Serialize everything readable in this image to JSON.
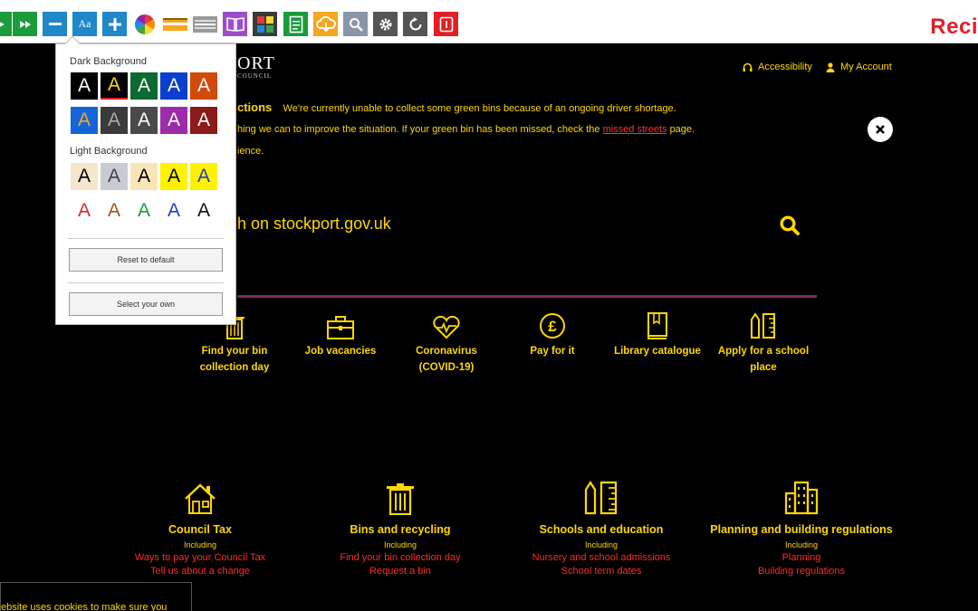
{
  "toolbar": {
    "text_size_label": "Aa",
    "brand": "Reci"
  },
  "header": {
    "logo_fragment": "ORT",
    "logo_sub": "COUNCIL",
    "accessibility": "Accessibility",
    "my_account": "My Account"
  },
  "alert": {
    "title": "ctions",
    "line1": "We're currently unable to collect some green bins because of an ongoing driver shortage.",
    "line2_pre": "hing we can to improve the situation. If your green bin has been missed, check the",
    "line2_link": "missed streets",
    "line2_post": "page.",
    "line3": "ience."
  },
  "search": {
    "text": "h on stockport.gov.uk"
  },
  "quick_links": [
    {
      "label": "Find your bin collection day",
      "icon": "bin-icon"
    },
    {
      "label": "Job vacancies",
      "icon": "briefcase-icon"
    },
    {
      "label": "Coronavirus (COVID-19)",
      "icon": "heartbeat-icon"
    },
    {
      "label": "Pay for it",
      "icon": "pound-icon"
    },
    {
      "label": "Library catalogue",
      "icon": "book-icon"
    },
    {
      "label": "Apply for a school place",
      "icon": "pencil-ruler-icon"
    }
  ],
  "services": [
    {
      "title": "Council Tax",
      "including": "Including",
      "links": [
        "Ways to pay your Council Tax",
        "Tell us about a change"
      ],
      "icon": "house-icon"
    },
    {
      "title": "Bins and recycling",
      "including": "Including",
      "links": [
        "Find your bin collection day",
        "Request a bin"
      ],
      "icon": "bin-icon"
    },
    {
      "title": "Schools and education",
      "including": "Including",
      "links": [
        "Nursery and school admissions",
        "School term dates"
      ],
      "icon": "pencil-ruler-icon"
    },
    {
      "title": "Planning and building regulations",
      "including": "Including",
      "links": [
        "Planning",
        "Building regulations"
      ],
      "icon": "buildings-icon"
    }
  ],
  "cookie": {
    "text": "ebsite uses cookies to make sure you"
  },
  "popup": {
    "dark_label": "Dark Background",
    "light_label": "Light Background",
    "letter": "A",
    "reset_label": "Reset to default",
    "own_label": "Select your own"
  },
  "colors": {
    "accent_yellow": "#ffd700",
    "link_red": "#ff2a2a",
    "toolbar_green": "#1a9b3c",
    "toolbar_blue": "#1e88c8"
  }
}
